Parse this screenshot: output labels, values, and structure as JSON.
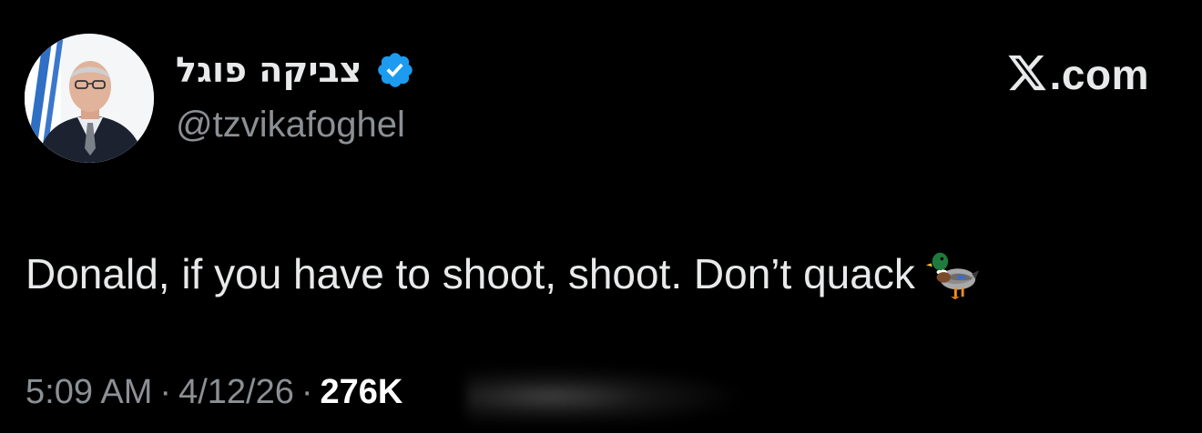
{
  "author": {
    "display_name": "צביקה פוגל",
    "handle": "@tzvikafoghel",
    "verified": true,
    "avatar": "profile-photo"
  },
  "brand": {
    "logo": "x-logo-icon",
    "suffix": ".com"
  },
  "tweet": {
    "text": "Donald, if you have to shoot, shoot. Don’t quack",
    "emoji": "duck-icon"
  },
  "meta": {
    "time": "5:09 AM",
    "separator": "·",
    "date": "4/12/26",
    "views": "276K"
  },
  "colors": {
    "background": "#000000",
    "text": "#e7e9ea",
    "secondary": "#8b9094",
    "verified": "#1d9bf0"
  }
}
